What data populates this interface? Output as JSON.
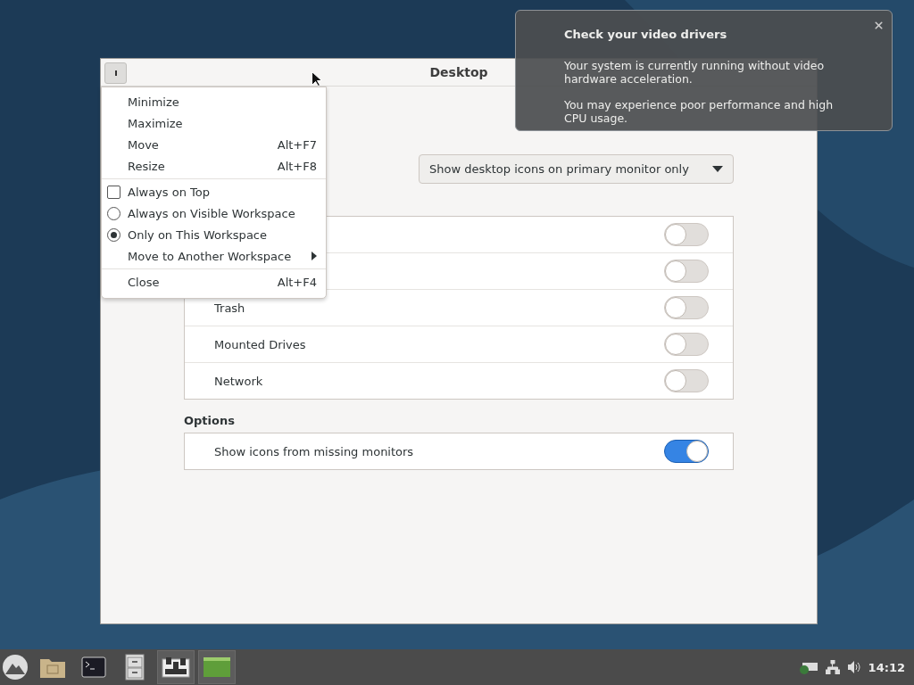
{
  "window": {
    "title": "Desktop"
  },
  "dropdown": {
    "value": "Show desktop icons on primary monitor only"
  },
  "icon_rows": [
    {
      "on": false
    },
    {
      "on": false
    },
    {
      "label": "Trash",
      "on": false
    },
    {
      "label": "Mounted Drives",
      "on": false
    },
    {
      "label": "Network",
      "on": false
    }
  ],
  "options": {
    "heading": "Options",
    "rows": [
      {
        "label": "Show icons from missing monitors",
        "on": true
      }
    ]
  },
  "window_menu": {
    "groups": [
      [
        {
          "kind": "plain",
          "label": "Minimize"
        },
        {
          "kind": "plain",
          "label": "Maximize"
        },
        {
          "kind": "plain",
          "label": "Move",
          "shortcut": "Alt+F7"
        },
        {
          "kind": "plain",
          "label": "Resize",
          "shortcut": "Alt+F8"
        }
      ],
      [
        {
          "kind": "check",
          "label": "Always on Top",
          "checked": false
        },
        {
          "kind": "radio",
          "label": "Always on Visible Workspace",
          "selected": false
        },
        {
          "kind": "radio",
          "label": "Only on This Workspace",
          "selected": true
        },
        {
          "kind": "submenu",
          "label": "Move to Another Workspace"
        }
      ],
      [
        {
          "kind": "plain",
          "label": "Close",
          "shortcut": "Alt+F4"
        }
      ]
    ]
  },
  "notification": {
    "title": "Check your video drivers",
    "paragraphs": [
      "Your system is currently running without video hardware acceleration.",
      "You may experience poor performance and high CPU usage."
    ]
  },
  "taskbar": {
    "apps": [
      {
        "kind": "folder",
        "active": false
      },
      {
        "kind": "terminal",
        "active": false
      },
      {
        "kind": "cabinet",
        "active": false
      },
      {
        "kind": "settings",
        "active": true
      },
      {
        "kind": "desktop",
        "active": true
      }
    ],
    "clock": "14:12"
  }
}
